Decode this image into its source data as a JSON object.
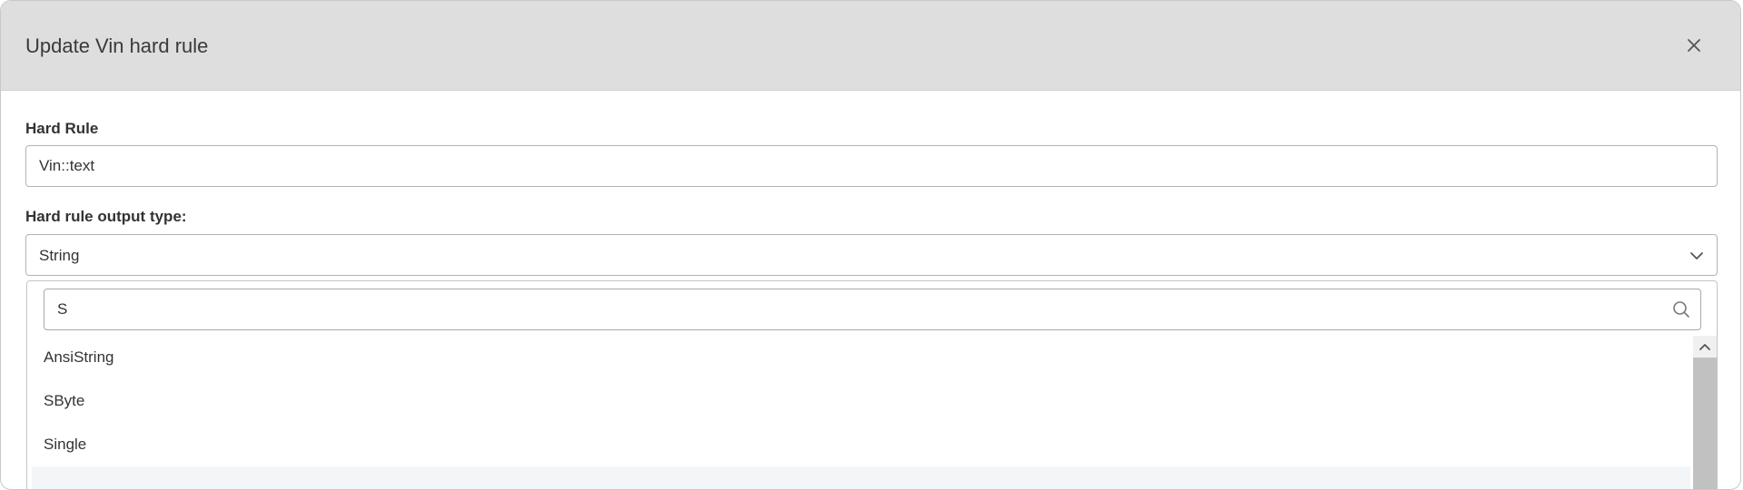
{
  "dialog": {
    "title": "Update Vin hard rule"
  },
  "hard_rule": {
    "label": "Hard Rule",
    "value": "Vin::text"
  },
  "output_type": {
    "label": "Hard rule output type:",
    "selected": "String"
  },
  "dropdown": {
    "search_value": "S",
    "options": [
      "AnsiString",
      "SByte",
      "Single",
      ""
    ]
  },
  "icons": {
    "close": "close-icon",
    "chevron": "chevron-down-icon",
    "search": "search-icon",
    "scroll_up": "chevron-up-icon"
  }
}
